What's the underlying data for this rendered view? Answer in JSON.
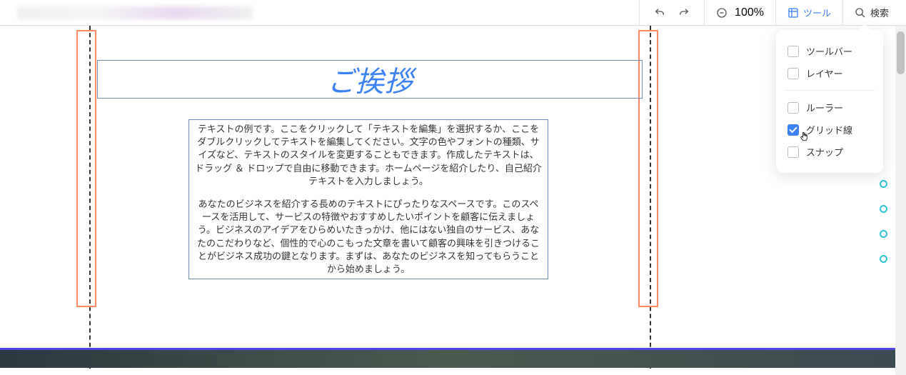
{
  "toolbar": {
    "zoom_level": "100%",
    "tools_label": "ツール",
    "search_label": "検索"
  },
  "dropdown": {
    "items": [
      {
        "label": "ツールバー",
        "checked": false
      },
      {
        "label": "レイヤー",
        "checked": false
      }
    ],
    "items2": [
      {
        "label": "ルーラー",
        "checked": false
      },
      {
        "label": "グリッド線",
        "checked": true
      },
      {
        "label": "スナップ",
        "checked": false
      }
    ]
  },
  "content": {
    "title": "ご挨拶",
    "paragraph1": "テキストの例です。ここをクリックして「テキストを編集」を選択するか、ここをダブルクリックしてテキストを編集してください。文字の色やフォントの種類、サイズなど、テキストのスタイルを変更することもできます。作成したテキストは、ドラッグ ＆ ドロップで自由に移動できます。ホームページを紹介したり、自己紹介テキストを入力しましょう。",
    "paragraph2": "あなたのビジネスを紹介する長めのテキストにぴったりなスペースです。このスペースを活用して、サービスの特徴やおすすめしたいポイントを顧客に伝えましょう。ビジネスのアイデアをひらめいたきっかけ、他にはない独自のサービス、あなたのこだわりなど、個性的で心のこもった文章を書いて顧客の興味を引きつけることがビジネス成功の鍵となります。まずは、あなたのビジネスを知ってもらうことから始めましょう。"
  }
}
